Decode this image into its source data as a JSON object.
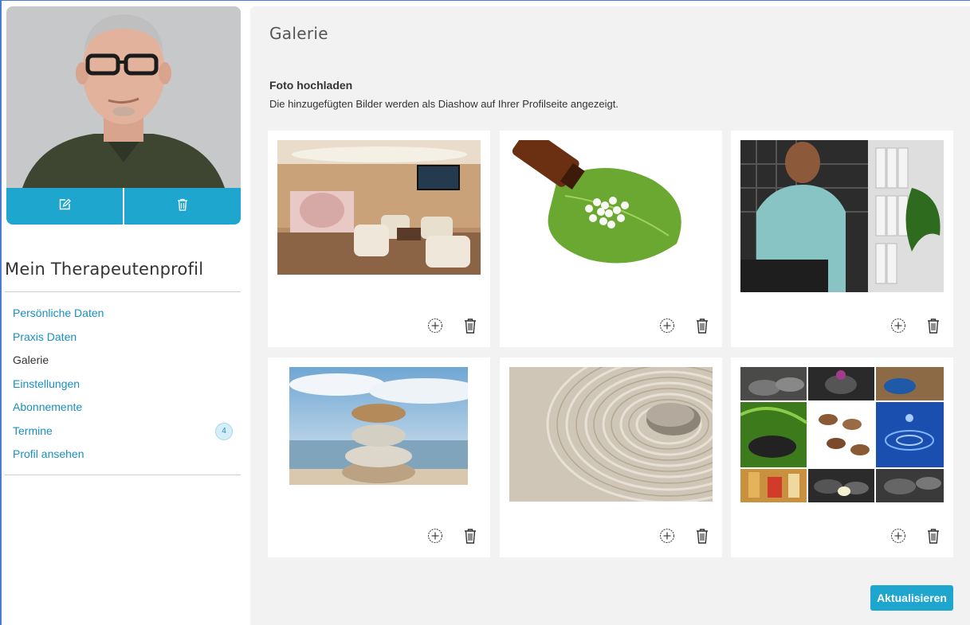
{
  "sidebar": {
    "profile_title": "Mein Therapeutenprofil",
    "nav": [
      {
        "label": "Persönliche Daten",
        "active": false
      },
      {
        "label": "Praxis Daten",
        "active": false
      },
      {
        "label": "Galerie",
        "active": true
      },
      {
        "label": "Einstellungen",
        "active": false
      },
      {
        "label": "Abonnemente",
        "active": false
      },
      {
        "label": "Termine",
        "active": false,
        "badge": "4"
      },
      {
        "label": "Profil ansehen",
        "active": false
      }
    ]
  },
  "main": {
    "title": "Galerie",
    "upload_title": "Foto hochladen",
    "upload_description": "Die hinzugefügten Bilder werden als Diashow auf Ihrer Profilseite angezeigt.",
    "update_button": "Aktualisieren"
  },
  "gallery": [
    {
      "subject": "reception-room"
    },
    {
      "subject": "homeopathy-globules-leaf"
    },
    {
      "subject": "woman-at-desk"
    },
    {
      "subject": "stacked-stones"
    },
    {
      "subject": "zen-sand-stone"
    },
    {
      "subject": "spa-collage"
    }
  ],
  "colors": {
    "accent": "#1fa6cf",
    "link": "#1a8fc0",
    "panel": "#f2f2f2"
  },
  "icons": {
    "edit": "edit-icon",
    "trash": "trash-icon",
    "add": "plus-circle-icon"
  }
}
